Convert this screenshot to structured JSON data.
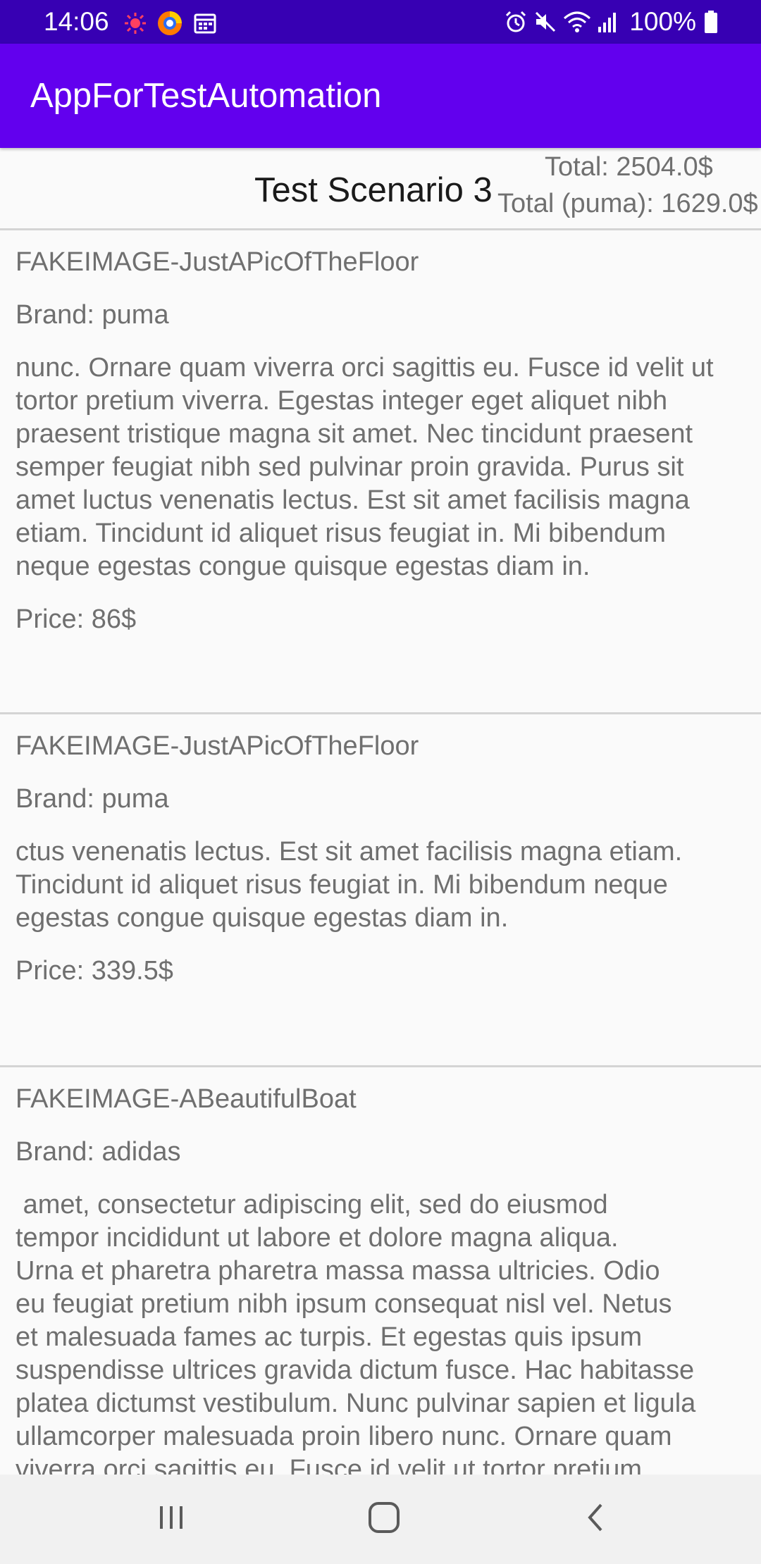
{
  "status_bar": {
    "time": "14:06",
    "battery": "100%",
    "left_icons": [
      "notification-dot-icon",
      "browser-icon",
      "calendar-icon"
    ],
    "right_icons": [
      "alarm-icon",
      "mute-icon",
      "wifi-icon",
      "signal-icon",
      "battery-icon"
    ]
  },
  "app_bar": {
    "title": "AppForTestAutomation",
    "color": "#6200ee",
    "status_color": "#3700b3"
  },
  "header": {
    "scenario_title": "Test Scenario 3",
    "total": "Total: 2504.0$",
    "total_puma": "Total (puma): 1629.0$"
  },
  "items": [
    {
      "image": "FAKEIMAGE-JustAPicOfTheFloor",
      "brand": "Brand: puma",
      "description": "nunc. Ornare quam viverra orci sagittis eu. Fusce id velit ut tortor pretium viverra. Egestas integer eget aliquet nibh praesent tristique magna sit amet. Nec tincidunt praesent semper feugiat nibh sed pulvinar proin gravida. Purus sit amet luctus venenatis lectus. Est sit amet facilisis magna etiam. Tincidunt id aliquet risus feugiat in. Mi bibendum neque egestas congue quisque egestas diam in.",
      "price": "Price: 86$"
    },
    {
      "image": "FAKEIMAGE-JustAPicOfTheFloor",
      "brand": "Brand: puma",
      "description": "ctus venenatis lectus. Est sit amet facilisis magna etiam. Tincidunt id aliquet risus feugiat in. Mi bibendum neque egestas congue quisque egestas diam in.",
      "price": "Price: 339.5$"
    },
    {
      "image": "FAKEIMAGE-ABeautifulBoat",
      "brand": "Brand: adidas",
      "description": " amet, consectetur adipiscing elit, sed do eiusmod\ntempor incididunt ut labore et dolore magna aliqua.\nUrna et pharetra pharetra massa massa ultricies. Odio\neu feugiat pretium nibh ipsum consequat nisl vel. Netus\net malesuada fames ac turpis. Et egestas quis ipsum\nsuspendisse ultrices gravida dictum fusce. Hac habitasse\nplatea dictumst vestibulum. Nunc pulvinar sapien et ligula\nullamcorper malesuada proin libero nunc. Ornare quam\nviverra orci sagittis eu. Fusce id velit ut tortor pretium"
    }
  ],
  "nav_bar": {
    "buttons": [
      "recents-icon",
      "home-icon",
      "back-icon"
    ]
  }
}
